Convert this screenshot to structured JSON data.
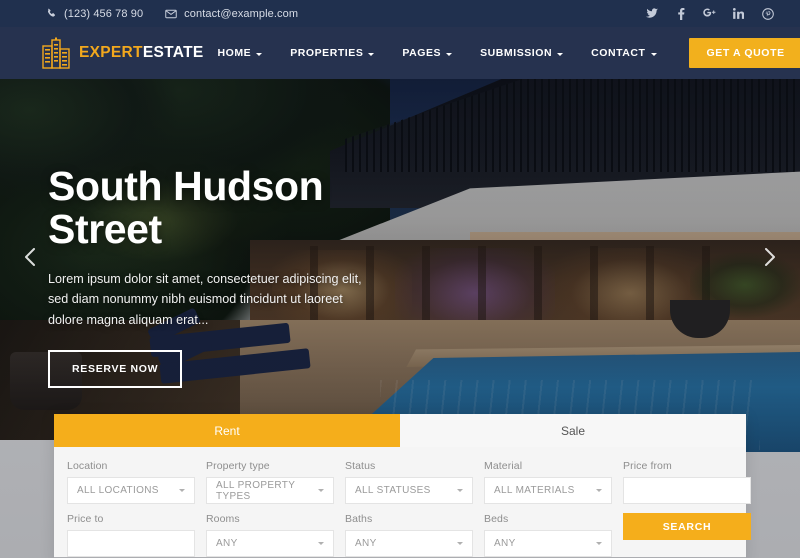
{
  "topbar": {
    "phone": "(123) 456 78 90",
    "email": "contact@example.com",
    "phone_icon": "phone-icon",
    "email_icon": "envelope-icon",
    "social": [
      {
        "name": "twitter-icon",
        "label": "Twitter"
      },
      {
        "name": "facebook-icon",
        "label": "Facebook"
      },
      {
        "name": "google-plus-icon",
        "label": "Google Plus"
      },
      {
        "name": "linkedin-icon",
        "label": "LinkedIn"
      },
      {
        "name": "pinterest-icon",
        "label": "Pinterest"
      }
    ]
  },
  "header": {
    "logo": {
      "word1": "EXPERT",
      "word2": "ESTATE",
      "icon": "building-icon"
    },
    "nav": [
      {
        "label": "HOME",
        "has_dropdown": true
      },
      {
        "label": "PROPERTIES",
        "has_dropdown": true
      },
      {
        "label": "PAGES",
        "has_dropdown": true
      },
      {
        "label": "SUBMISSION",
        "has_dropdown": true
      },
      {
        "label": "CONTACT",
        "has_dropdown": true
      }
    ],
    "quote_button": "GET A QUOTE"
  },
  "hero": {
    "title_line1": "South Hudson",
    "title_line2": "Street",
    "description": "Lorem ipsum dolor sit amet, consectetuer adipiscing elit, sed diam nonummy nibh euismod tincidunt ut laoreet dolore magna aliquam erat...",
    "cta": "RESERVE NOW",
    "prev_arrow": "chevron-left-icon",
    "next_arrow": "chevron-right-icon"
  },
  "search": {
    "tabs": [
      {
        "label": "Rent",
        "active": true
      },
      {
        "label": "Sale",
        "active": false
      }
    ],
    "row1": [
      {
        "label": "Location",
        "value": "ALL LOCATIONS",
        "type": "select"
      },
      {
        "label": "Property type",
        "value": "ALL PROPERTY TYPES",
        "type": "select"
      },
      {
        "label": "Status",
        "value": "ALL STATUSES",
        "type": "select"
      },
      {
        "label": "Material",
        "value": "ALL MATERIALS",
        "type": "select"
      },
      {
        "label": "Price from",
        "value": "",
        "type": "input"
      }
    ],
    "row2": [
      {
        "label": "Price to",
        "value": "",
        "type": "input"
      },
      {
        "label": "Rooms",
        "value": "ANY",
        "type": "select"
      },
      {
        "label": "Baths",
        "value": "ANY",
        "type": "select"
      },
      {
        "label": "Beds",
        "value": "ANY",
        "type": "select"
      }
    ],
    "submit": "SEARCH"
  },
  "colors": {
    "topbar_bg": "#20304e",
    "header_bg": "#26324f",
    "accent": "#f2b01d",
    "tab_active": "#f5ae1b",
    "panel_bg": "#f5f5f5"
  }
}
